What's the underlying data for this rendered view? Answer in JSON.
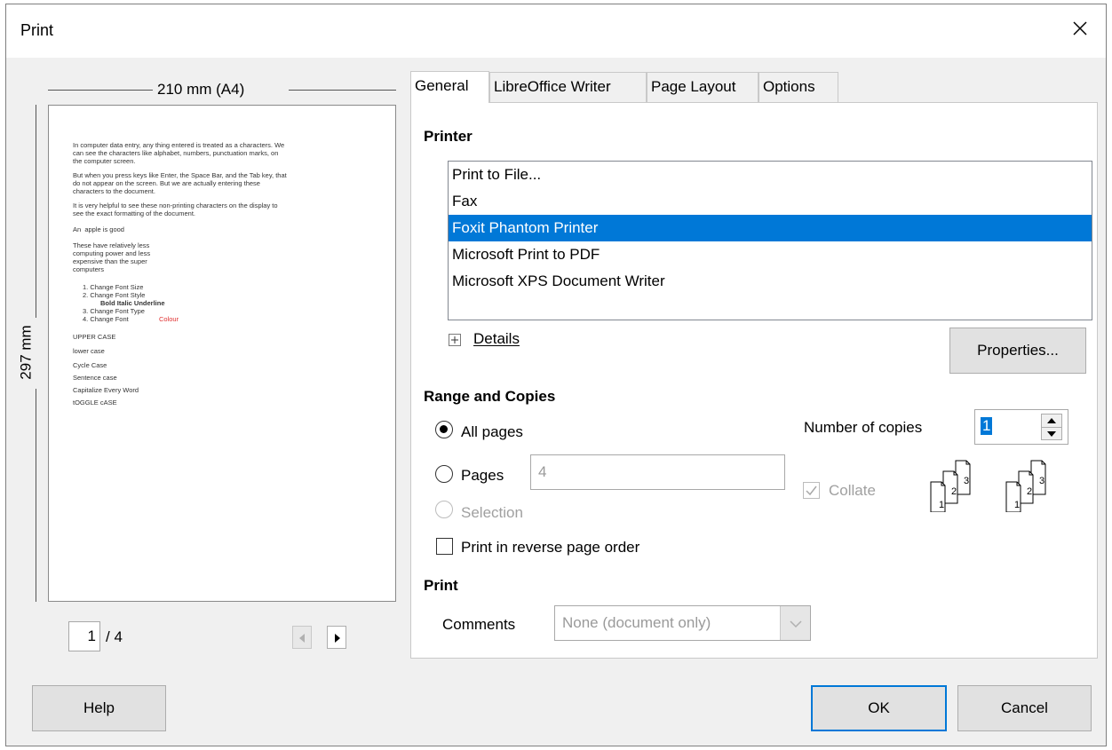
{
  "window": {
    "title": "Print"
  },
  "preview": {
    "width_label": "210 mm (A4)",
    "height_label": "297 mm",
    "page_current": "1",
    "page_total": "/ 4",
    "lines": [
      "In computer data entry, any thing entered is treated as a characters. We",
      "can see the characters like alphabet, numbers, punctuation marks, on",
      "the computer screen.",
      "But when you press keys like Enter, the Space Bar, and the Tab key, that",
      "do not appear on the screen. But we are actually entering these",
      "characters to the document.",
      "It is very helpful to see these non-printing characters on the display to",
      "see the exact formatting of the document.",
      "An  apple is good",
      "These have relatively less",
      "computing power and less",
      "expensive than the super",
      "computers",
      "1. Change Font Size",
      "2. Change Font Style",
      "Bold Italic Underline",
      "3. Change Font Type",
      "4. Change Font ",
      "Colour",
      "UPPER CASE",
      "lower case",
      "Cycle Case",
      "Sentence case",
      "Capitalize Every Word",
      "tOGGLE cASE"
    ]
  },
  "tabs": [
    "General",
    "LibreOffice Writer",
    "Page Layout",
    "Options"
  ],
  "printer": {
    "heading": "Printer",
    "items": [
      "Print to File...",
      "Fax",
      "Foxit Phantom Printer",
      "Microsoft Print to PDF",
      "Microsoft XPS Document Writer"
    ],
    "selected_index": 2,
    "details_label": "Details",
    "properties_label": "Properties..."
  },
  "range": {
    "heading": "Range and Copies",
    "all_pages": "All pages",
    "pages": "Pages",
    "pages_value": "4",
    "selection": "Selection",
    "reverse": "Print in reverse page order",
    "copies_label": "Number of copies",
    "copies_value": "1",
    "collate": "Collate"
  },
  "print_section": {
    "heading": "Print",
    "comments_label": "Comments",
    "comments_value": "None (document only)"
  },
  "buttons": {
    "help": "Help",
    "ok": "OK",
    "cancel": "Cancel"
  },
  "colors": {
    "selection": "#0078d7",
    "dialog_bg": "#f0f0f0",
    "disabled": "#a0a0a0"
  }
}
